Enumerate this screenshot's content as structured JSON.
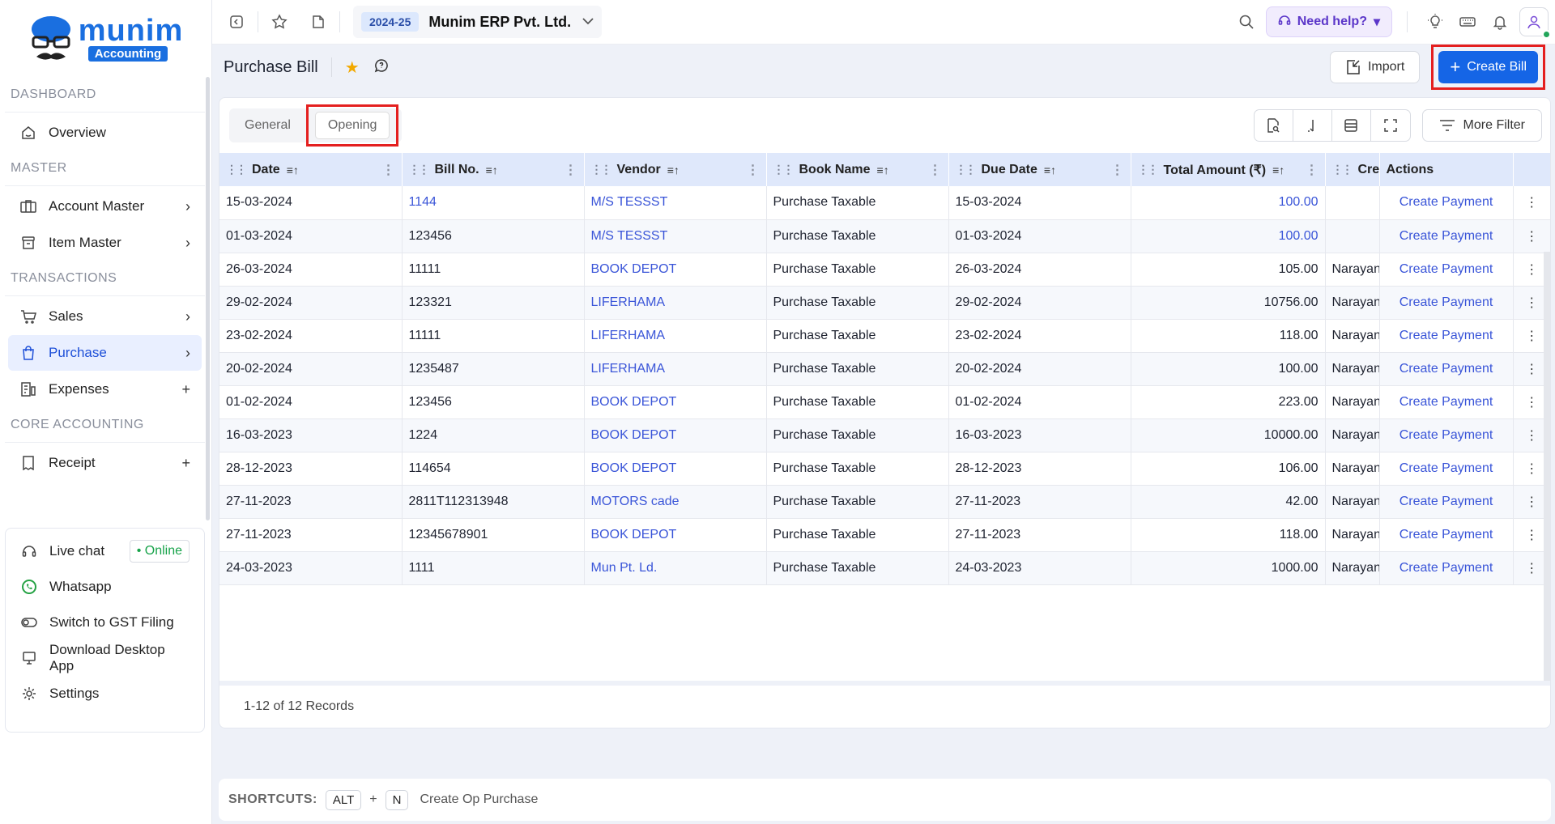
{
  "brand": {
    "word": "munim",
    "badge": "Accounting"
  },
  "sidebar": {
    "sections": [
      {
        "title": "DASHBOARD",
        "items": [
          {
            "label": "Overview",
            "icon": "home-icon",
            "trail": ""
          }
        ]
      },
      {
        "title": "MASTER",
        "items": [
          {
            "label": "Account Master",
            "icon": "account-icon",
            "trail": "›"
          },
          {
            "label": "Item Master",
            "icon": "box-icon",
            "trail": "›"
          }
        ]
      },
      {
        "title": "TRANSACTIONS",
        "items": [
          {
            "label": "Sales",
            "icon": "cart-icon",
            "trail": "›"
          },
          {
            "label": "Purchase",
            "icon": "bag-icon",
            "trail": "›"
          },
          {
            "label": "Expenses",
            "icon": "expense-icon",
            "trail": "+"
          }
        ]
      },
      {
        "title": "CORE ACCOUNTING",
        "items": [
          {
            "label": "Receipt",
            "icon": "receipt-icon",
            "trail": "+"
          }
        ]
      }
    ],
    "bottom": {
      "live_chat": "Live chat",
      "online": "• Online",
      "whatsapp": "Whatsapp",
      "gst": "Switch to GST Filing",
      "download": "Download Desktop App",
      "settings": "Settings"
    }
  },
  "topbar": {
    "year": "2024-25",
    "company": "Munim ERP Pvt. Ltd.",
    "help": "Need help?"
  },
  "page": {
    "title": "Purchase Bill",
    "import_label": "Import",
    "create_label": "Create Bill"
  },
  "tabs": {
    "general": "General",
    "opening": "Opening"
  },
  "filter_label": "More Filter",
  "table": {
    "headers": [
      "Date",
      "Bill No.",
      "Vendor",
      "Book Name",
      "Due Date",
      "Total Amount (₹)",
      "Crea",
      "Actions"
    ],
    "rows": [
      {
        "date": "15-03-2024",
        "bill": "1144",
        "bill_link": true,
        "vendor": "M/S TESSST",
        "book": "Purchase Taxable",
        "due": "15-03-2024",
        "amount": "100.00",
        "amount_link": true,
        "created": ""
      },
      {
        "date": "01-03-2024",
        "bill": "123456",
        "bill_link": false,
        "vendor": "M/S TESSST",
        "book": "Purchase Taxable",
        "due": "01-03-2024",
        "amount": "100.00",
        "amount_link": true,
        "created": ""
      },
      {
        "date": "26-03-2024",
        "bill": "11111",
        "bill_link": false,
        "vendor": "BOOK DEPOT",
        "book": "Purchase Taxable",
        "due": "26-03-2024",
        "amount": "105.00",
        "amount_link": false,
        "created": "Narayan"
      },
      {
        "date": "29-02-2024",
        "bill": "123321",
        "bill_link": false,
        "vendor": "LIFERHAMA",
        "book": "Purchase Taxable",
        "due": "29-02-2024",
        "amount": "10756.00",
        "amount_link": false,
        "created": "Narayan"
      },
      {
        "date": "23-02-2024",
        "bill": "11111",
        "bill_link": false,
        "vendor": "LIFERHAMA",
        "book": "Purchase Taxable",
        "due": "23-02-2024",
        "amount": "118.00",
        "amount_link": false,
        "created": "Narayan"
      },
      {
        "date": "20-02-2024",
        "bill": "1235487",
        "bill_link": false,
        "vendor": "LIFERHAMA",
        "book": "Purchase Taxable",
        "due": "20-02-2024",
        "amount": "100.00",
        "amount_link": false,
        "created": "Narayan"
      },
      {
        "date": "01-02-2024",
        "bill": "123456",
        "bill_link": false,
        "vendor": "BOOK DEPOT",
        "book": "Purchase Taxable",
        "due": "01-02-2024",
        "amount": "223.00",
        "amount_link": false,
        "created": "Narayan"
      },
      {
        "date": "16-03-2023",
        "bill": "1224",
        "bill_link": false,
        "vendor": "BOOK DEPOT",
        "book": "Purchase Taxable",
        "due": "16-03-2023",
        "amount": "10000.00",
        "amount_link": false,
        "created": "Narayan"
      },
      {
        "date": "28-12-2023",
        "bill": "114654",
        "bill_link": false,
        "vendor": "BOOK DEPOT",
        "book": "Purchase Taxable",
        "due": "28-12-2023",
        "amount": "106.00",
        "amount_link": false,
        "created": "Narayan"
      },
      {
        "date": "27-11-2023",
        "bill": "2811T112313948",
        "bill_link": false,
        "vendor": "MOTORS cade",
        "book": "Purchase Taxable",
        "due": "27-11-2023",
        "amount": "42.00",
        "amount_link": false,
        "created": "Narayan"
      },
      {
        "date": "27-11-2023",
        "bill": "12345678901",
        "bill_link": false,
        "vendor": "BOOK DEPOT",
        "book": "Purchase Taxable",
        "due": "27-11-2023",
        "amount": "118.00",
        "amount_link": false,
        "created": "Narayan"
      },
      {
        "date": "24-03-2023",
        "bill": "1111",
        "bill_link": false,
        "vendor": "Mun Pt. Ld.",
        "book": "Purchase Taxable",
        "due": "24-03-2023",
        "amount": "1000.00",
        "amount_link": false,
        "created": "Narayan"
      }
    ],
    "action_label": "Create Payment"
  },
  "records": "1-12 of 12 Records",
  "shortcuts": {
    "title": "SHORTCUTS:",
    "key1": "ALT",
    "plus": "+",
    "key2": "N",
    "desc": "Create Op Purchase"
  }
}
